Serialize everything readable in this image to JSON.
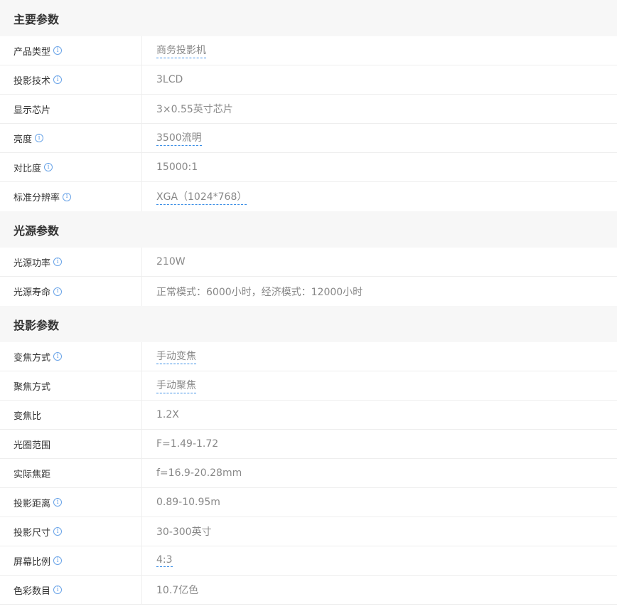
{
  "sections": [
    {
      "title": "主要参数",
      "rows": [
        {
          "label": "产品类型",
          "value": "商务投影机"
        },
        {
          "label": "投影技术",
          "value": "3LCD"
        },
        {
          "label": "显示芯片",
          "value": "3×0.55英寸芯片"
        },
        {
          "label": "亮度",
          "value": "3500流明"
        },
        {
          "label": "对比度",
          "value": "15000:1"
        },
        {
          "label": "标准分辨率",
          "value": "XGA（1024*768）"
        }
      ]
    },
    {
      "title": "光源参数",
      "rows": [
        {
          "label": "光源功率",
          "value": "210W"
        },
        {
          "label": "光源寿命",
          "value": "正常模式：6000小时，经济模式：12000小时"
        }
      ]
    },
    {
      "title": "投影参数",
      "rows": [
        {
          "label": "变焦方式",
          "value": "手动变焦"
        },
        {
          "label": "聚焦方式",
          "value": "手动聚焦"
        },
        {
          "label": "变焦比",
          "value": "1.2X"
        },
        {
          "label": "光圈范围",
          "value": "F=1.49-1.72"
        },
        {
          "label": "实际焦距",
          "value": "f=16.9-20.28mm"
        },
        {
          "label": "投影距离",
          "value": "0.89-10.95m"
        },
        {
          "label": "投影尺寸",
          "value": "30-300英寸"
        },
        {
          "label": "屏幕比例",
          "value": "4:3"
        },
        {
          "label": "色彩数目",
          "value": "10.7亿色"
        }
      ]
    }
  ],
  "info_icon": {
    "glyph": "i",
    "name": "info-icon",
    "color": "#6aa4e8"
  },
  "colors": {
    "link_underline": "#3a8ee6",
    "section_bg": "#f7f7f7",
    "value_text": "#888888"
  }
}
